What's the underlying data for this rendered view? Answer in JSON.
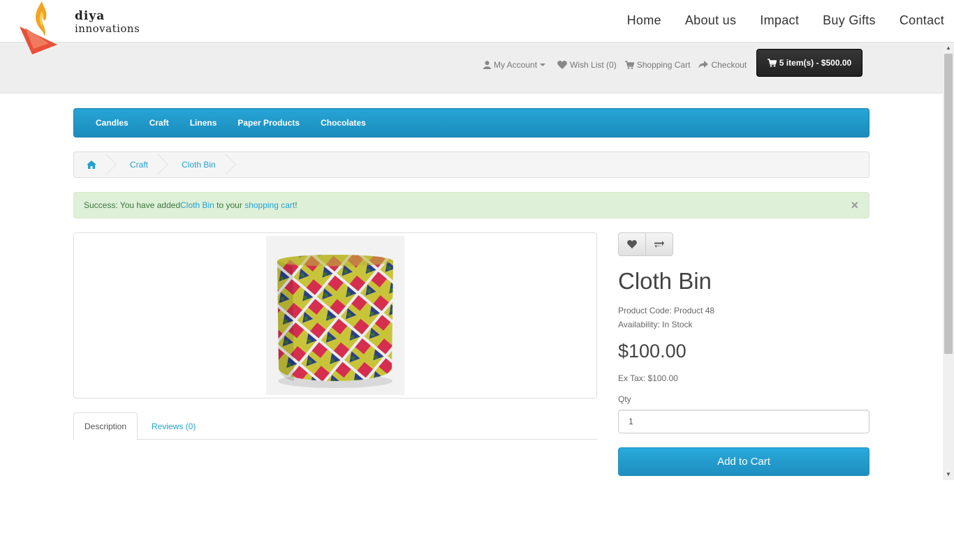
{
  "header": {
    "logo_line1": "diya",
    "logo_line2": "innovations",
    "nav": [
      "Home",
      "About us",
      "Impact",
      "Buy Gifts",
      "Contact"
    ]
  },
  "topbar": {
    "my_account": "My Account",
    "wish_list": "Wish List (0)",
    "shopping_cart": "Shopping Cart",
    "checkout": "Checkout",
    "cart_button": "5 item(s) - $500.00"
  },
  "categories": [
    "Candles",
    "Craft",
    "Linens",
    "Paper Products",
    "Chocolates"
  ],
  "breadcrumb": [
    "Craft",
    "Cloth Bin"
  ],
  "alert": {
    "prefix": "Success: You have added ",
    "product_link": "Cloth Bin",
    "middle": " to your ",
    "cart_link": "shopping cart",
    "suffix": "!",
    "close": "×"
  },
  "tabs": {
    "description": "Description",
    "reviews": "Reviews (0)"
  },
  "product": {
    "title": "Cloth Bin",
    "code": "Product Code: Product 48",
    "availability": "Availability: In Stock",
    "price": "$100.00",
    "ex_tax": "Ex Tax: $100.00",
    "qty_label": "Qty",
    "qty_value": "1",
    "add_to_cart": "Add to Cart"
  },
  "colors": {
    "accent": "#23a1d1",
    "alert_bg": "#dff0d8",
    "cart_button": "#2b2b2b"
  }
}
